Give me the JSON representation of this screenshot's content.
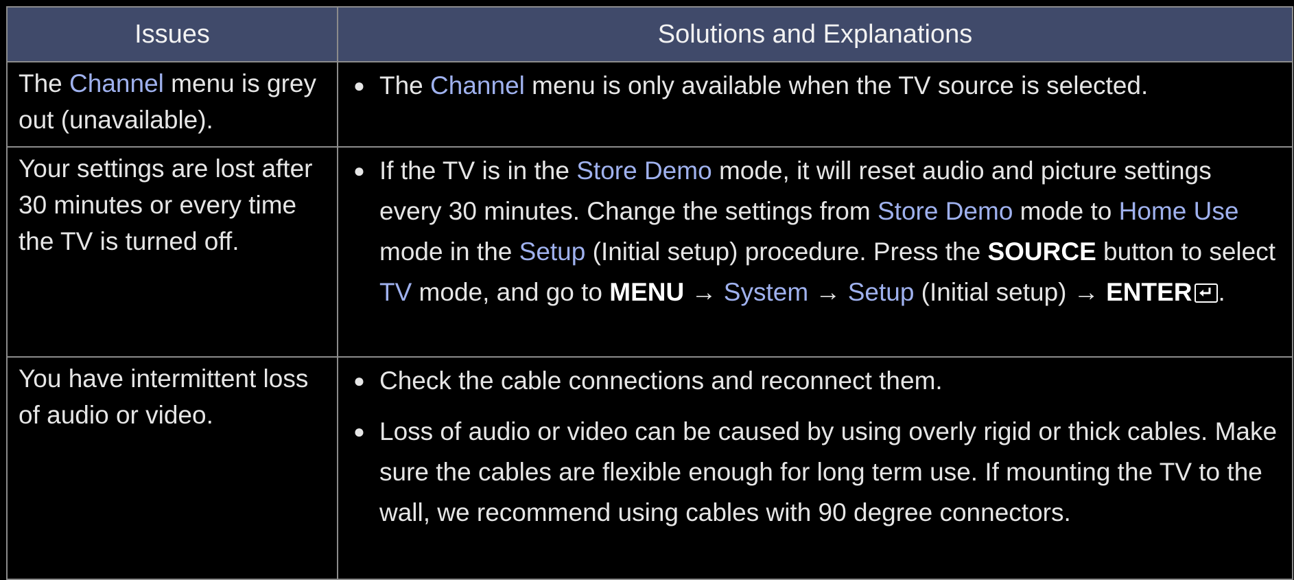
{
  "header": {
    "issues": "Issues",
    "solutions": "Solutions and Explanations"
  },
  "rows": [
    {
      "issue": {
        "p1": "The ",
        "k1": "Channel",
        "p2": " menu is grey out (unavailable)."
      },
      "bullets": [
        {
          "s1": "The ",
          "k1": "Channel",
          "s2": " menu is only available when the TV source is selected."
        }
      ]
    },
    {
      "issue": {
        "text": "Your settings are lost after 30 minutes or every time the TV is turned off."
      },
      "bullets": [
        {
          "s1": "If the TV is in the ",
          "k1": "Store Demo",
          "s2": " mode, it will reset audio and picture settings every 30 minutes. Change the settings from ",
          "k2": "Store Demo",
          "s3": " mode to ",
          "k3": "Home Use",
          "s4": " mode in the ",
          "k4": "Setup",
          "s5": " (Initial setup) procedure. Press the ",
          "k5": "SOURCE",
          "s6": " button to select ",
          "k6": "TV",
          "s7": " mode, and go to ",
          "k7": "MENU",
          "s8": " → ",
          "k8": "System",
          "s9": " → ",
          "k9": "Setup",
          "s10": " (Initial setup) → ",
          "k10": "ENTER",
          "s11": "."
        }
      ]
    },
    {
      "issue": {
        "text": "You have intermittent loss of audio or video."
      },
      "bullets": [
        {
          "text": "Check the cable connections and reconnect them."
        },
        {
          "text": "Loss of audio or video can be caused by using overly rigid or thick cables. Make sure the cables are flexible enough for long term use. If mounting the TV to the wall, we recommend using cables with 90 degree connectors."
        }
      ]
    }
  ],
  "bullet_symbol": "●",
  "icons": {
    "enter": "enter-key-icon"
  },
  "colors": {
    "header_bg": "#404a6a",
    "keyword_blue": "#9fb1ee",
    "border": "#8c8c8c",
    "background": "#000000"
  }
}
